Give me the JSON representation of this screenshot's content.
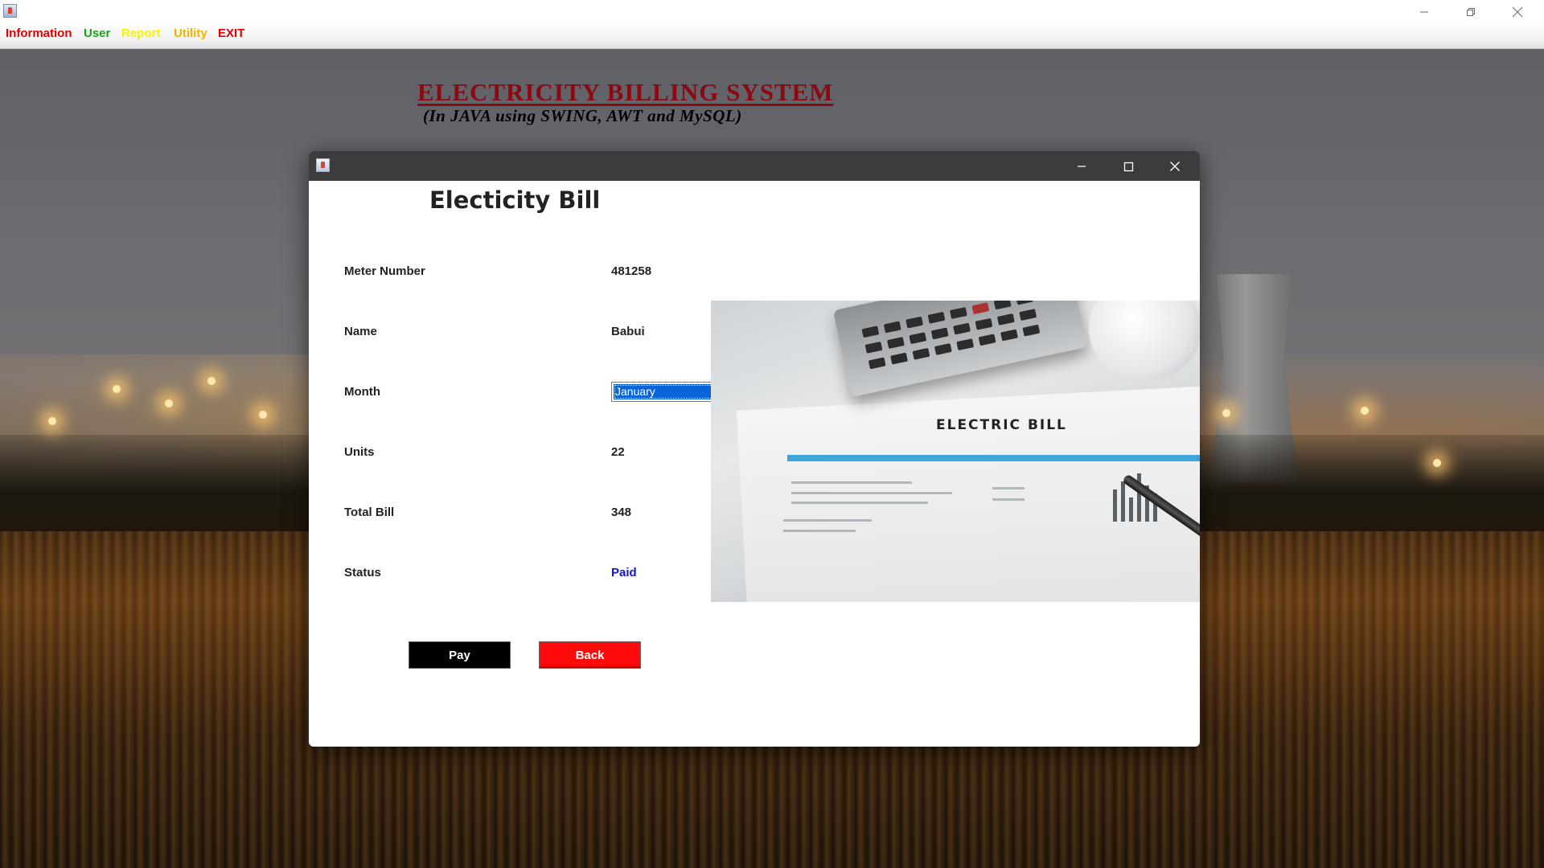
{
  "window": {
    "icon": "java-icon",
    "controls": [
      "minimize-icon",
      "restore-icon",
      "close-icon"
    ]
  },
  "menu": {
    "items": [
      {
        "label": "Information",
        "color": "#e00000"
      },
      {
        "label": "User",
        "color": "#1aa31a"
      },
      {
        "label": "Report",
        "color": "#f5f500"
      },
      {
        "label": "Utility",
        "color": "#f0b400"
      },
      {
        "label": "EXIT",
        "color": "#e00000"
      }
    ]
  },
  "header": {
    "title": "ELECTRICITY BILLING SYSTEM",
    "subtitle": "(In JAVA using SWING, AWT and MySQL)"
  },
  "dialog": {
    "heading": "Electicity Bill",
    "fields": {
      "meter_number": {
        "label": "Meter Number",
        "value": "481258"
      },
      "name": {
        "label": "Name",
        "value": "Babui"
      },
      "month": {
        "label": "Month",
        "selected": "January"
      },
      "units": {
        "label": "Units",
        "value": "22"
      },
      "total_bill": {
        "label": "Total Bill",
        "value": "348"
      },
      "status": {
        "label": "Status",
        "value": "Paid"
      }
    },
    "image_caption": "ELECTRIC BILL",
    "buttons": {
      "pay": "Pay",
      "back": "Back"
    }
  },
  "colors": {
    "title": "#8b0a12",
    "status_value": "#1414d2",
    "pay_button": "#000000",
    "back_button": "#ff0a0a",
    "select_highlight": "#0a64d8"
  }
}
